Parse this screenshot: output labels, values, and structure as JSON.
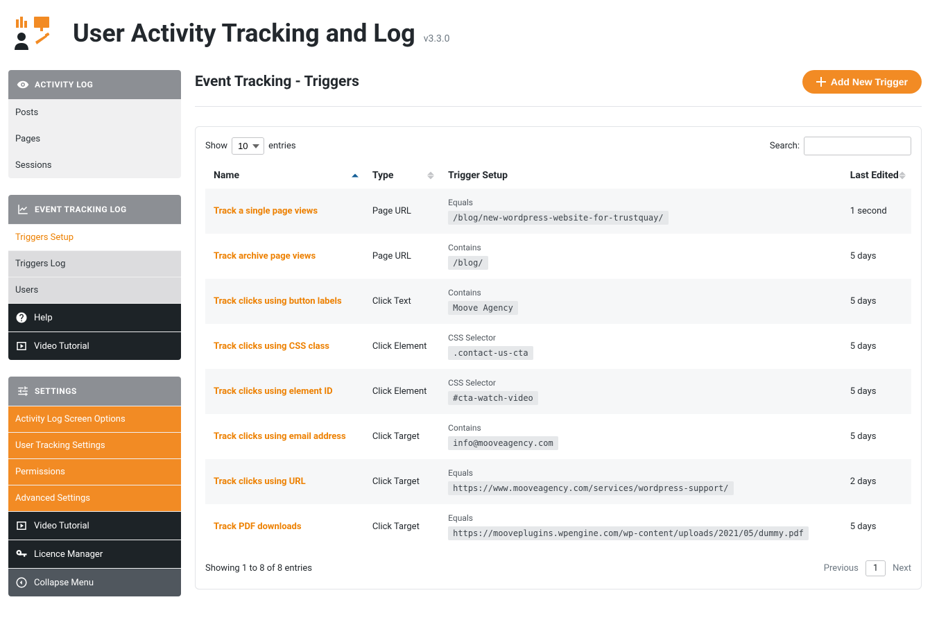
{
  "app": {
    "title": "User Activity Tracking and Log",
    "version": "v3.3.0"
  },
  "colors": {
    "accent": "#f28b24",
    "link": "#ed8000"
  },
  "sidebar": {
    "sections": [
      {
        "title": "ACTIVITY LOG",
        "icon": "eye-icon",
        "items": [
          {
            "label": "Posts",
            "style": "light"
          },
          {
            "label": "Pages",
            "style": "light"
          },
          {
            "label": "Sessions",
            "style": "light"
          }
        ]
      },
      {
        "title": "EVENT TRACKING LOG",
        "icon": "chart-up-icon",
        "items": [
          {
            "label": "Triggers Setup",
            "style": "active"
          },
          {
            "label": "Triggers Log",
            "style": "default"
          },
          {
            "label": "Users",
            "style": "default"
          },
          {
            "label": "Help",
            "style": "dark",
            "icon": "help-icon"
          },
          {
            "label": "Video Tutorial",
            "style": "dark",
            "icon": "video-icon"
          }
        ]
      },
      {
        "title": "SETTINGS",
        "icon": "sliders-icon",
        "items": [
          {
            "label": "Activity Log Screen Options",
            "style": "orange"
          },
          {
            "label": "User Tracking Settings",
            "style": "orange"
          },
          {
            "label": "Permissions",
            "style": "orange"
          },
          {
            "label": "Advanced Settings",
            "style": "orange"
          },
          {
            "label": "Video Tutorial",
            "style": "dark",
            "icon": "video-icon"
          },
          {
            "label": "Licence Manager",
            "style": "dark",
            "icon": "key-icon"
          },
          {
            "label": "Collapse Menu",
            "style": "gray-dark",
            "icon": "collapse-icon"
          }
        ]
      }
    ]
  },
  "page": {
    "title": "Event Tracking - Triggers",
    "add_button": "Add New Trigger"
  },
  "table": {
    "show_label_pre": "Show",
    "show_label_post": "entries",
    "show_value": "10",
    "search_label": "Search:",
    "search_value": "",
    "columns": [
      {
        "label": "Name",
        "sort": "asc"
      },
      {
        "label": "Type",
        "sort": "none"
      },
      {
        "label": "Trigger Setup",
        "sort": "none"
      },
      {
        "label": "Last Edited",
        "sort": "none"
      }
    ],
    "rows": [
      {
        "name": "Track a single page views",
        "type": "Page URL",
        "setup_op": "Equals",
        "setup_val": "/blog/new-wordpress-website-for-trustquay/",
        "edited": "1 second"
      },
      {
        "name": "Track archive page views",
        "type": "Page URL",
        "setup_op": "Contains",
        "setup_val": "/blog/",
        "edited": "5 days"
      },
      {
        "name": "Track clicks using button labels",
        "type": "Click Text",
        "setup_op": "Contains",
        "setup_val": "Moove Agency",
        "edited": "5 days"
      },
      {
        "name": "Track clicks using CSS class",
        "type": "Click Element",
        "setup_op": "CSS Selector",
        "setup_val": ".contact-us-cta",
        "edited": "5 days"
      },
      {
        "name": "Track clicks using element ID",
        "type": "Click Element",
        "setup_op": "CSS Selector",
        "setup_val": "#cta-watch-video",
        "edited": "5 days"
      },
      {
        "name": "Track clicks using email address",
        "type": "Click Target",
        "setup_op": "Contains",
        "setup_val": "info@mooveagency.com",
        "edited": "5 days"
      },
      {
        "name": "Track clicks using URL",
        "type": "Click Target",
        "setup_op": "Equals",
        "setup_val": "https://www.mooveagency.com/services/wordpress-support/",
        "edited": "2 days"
      },
      {
        "name": "Track PDF downloads",
        "type": "Click Target",
        "setup_op": "Equals",
        "setup_val": "https://mooveplugins.wpengine.com/wp-content/uploads/2021/05/dummy.pdf",
        "edited": "5 days"
      }
    ],
    "info": "Showing 1 to 8 of 8 entries",
    "pager": {
      "prev": "Previous",
      "current": "1",
      "next": "Next"
    }
  }
}
